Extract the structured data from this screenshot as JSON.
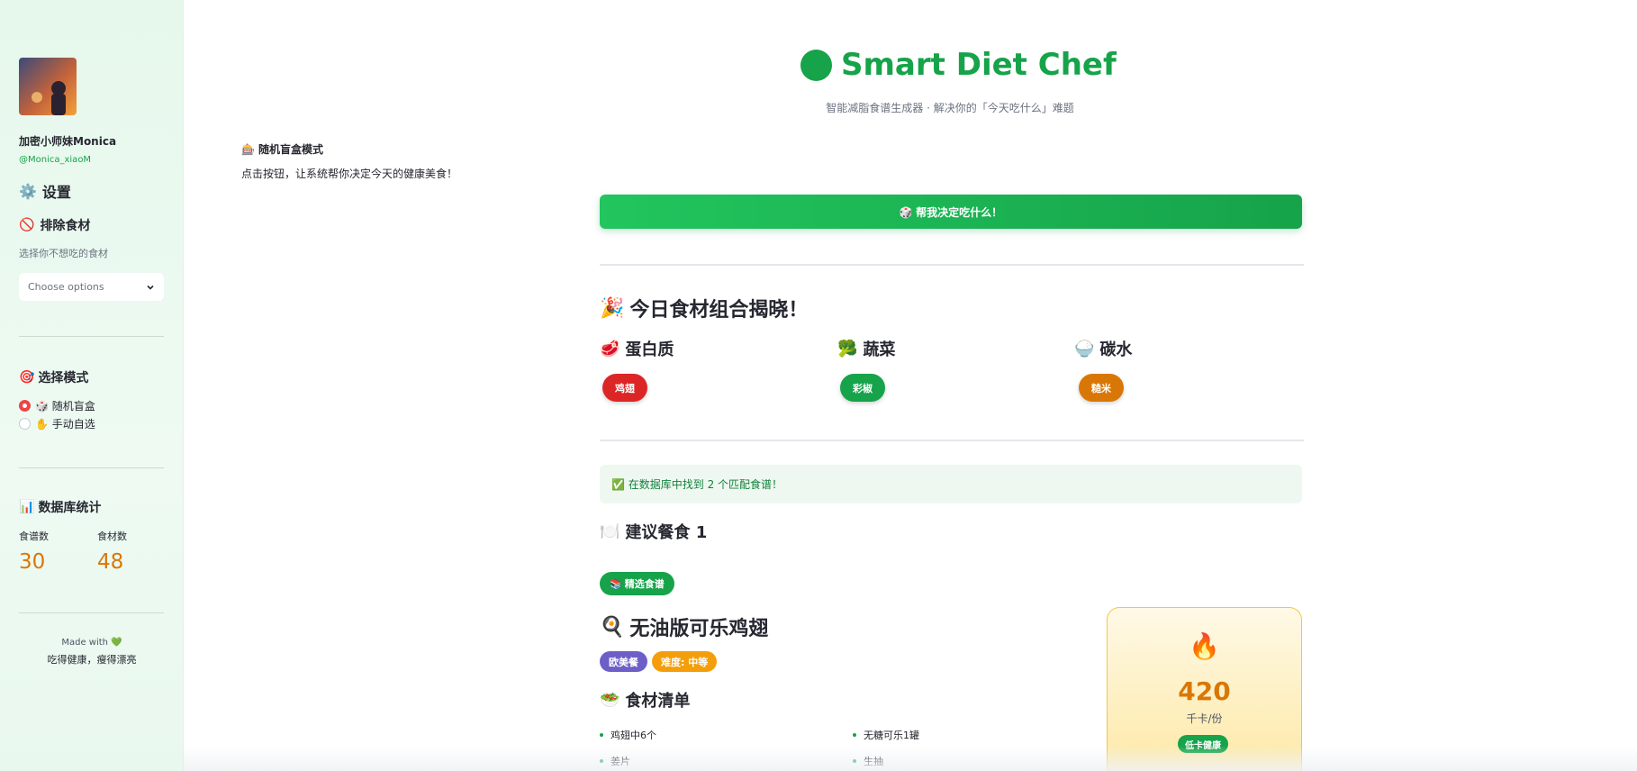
{
  "sidebar": {
    "user_name": "加密小师妹Monica",
    "user_handle": "@Monica_xiaoM",
    "settings_label": "设置",
    "exclude_title": "排除食材",
    "exclude_hint": "选择你不想吃的食材",
    "exclude_placeholder": "Choose options",
    "mode_title": "选择模式",
    "mode_options": [
      {
        "label": "🎲 随机盲盒",
        "selected": true
      },
      {
        "label": "✋ 手动自选",
        "selected": false
      }
    ],
    "stats_title": "数据库统计",
    "stats": [
      {
        "label": "食谱数",
        "value": "30"
      },
      {
        "label": "食材数",
        "value": "48"
      }
    ],
    "footer_made": "Made with 💚",
    "footer_slogan": "吃得健康，瘦得漂亮",
    "accent_color": "#16a34a"
  },
  "header": {
    "title": "Smart Diet Chef",
    "subtitle": "智能减脂食谱生成器 · 解决你的「今天吃什么」难题"
  },
  "mode_note": {
    "title": "随机盲盒模式",
    "text": "点击按钮，让系统帮你决定今天的健康美食！"
  },
  "decide_button": "🎲 帮我决定吃什么！",
  "reveal": {
    "title": "今日食材组合揭晓！",
    "categories": [
      {
        "label": "蛋白质",
        "icon": "meat-icon",
        "item": "鸡翅",
        "color": "#dc2626"
      },
      {
        "label": "蔬菜",
        "icon": "broccoli-icon",
        "item": "彩椒",
        "color": "#16a34a"
      },
      {
        "label": "碳水",
        "icon": "rice-icon",
        "item": "糙米",
        "color": "#d97706"
      }
    ]
  },
  "result_message": "✅ 在数据库中找到 2 个匹配食谱！",
  "meal": {
    "title": "建议餐食 1",
    "badge": "精选食谱",
    "recipe_name": "无油版可乐鸡翅",
    "tags": [
      {
        "label": "欧美餐",
        "color": "#6d5fc7"
      },
      {
        "label": "难度: 中等",
        "color": "#f59e0b"
      }
    ],
    "ingredients_title": "食材清单",
    "ingredients": [
      "鸡翅中6个",
      "无糖可乐1罐",
      "姜片",
      "生抽"
    ],
    "calories": {
      "value": "420",
      "unit": "千卡/份",
      "badge": "低卡健康"
    }
  }
}
